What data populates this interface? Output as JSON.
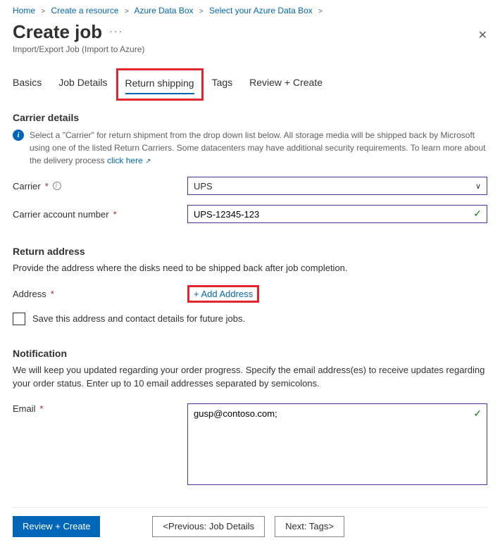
{
  "breadcrumb": [
    "Home",
    "Create a resource",
    "Azure Data Box",
    "Select your Azure Data Box"
  ],
  "page": {
    "title": "Create job",
    "subtitle": "Import/Export Job (Import to Azure)"
  },
  "tabs": {
    "basics": "Basics",
    "job_details": "Job Details",
    "return_shipping": "Return shipping",
    "tags": "Tags",
    "review": "Review + Create"
  },
  "carrier_section": {
    "heading": "Carrier details",
    "info_text": "Select a \"Carrier\" for return shipment from the drop down list below. All storage media will be shipped back by Microsoft using one of the listed Return Carriers. Some datacenters may have additional security requirements. To learn more about the delivery process ",
    "info_link": "click here",
    "carrier_label": "Carrier",
    "carrier_value": "UPS",
    "account_label": "Carrier account number",
    "account_value": "UPS-12345-123"
  },
  "return_section": {
    "heading": "Return address",
    "desc": "Provide the address where the disks need to be shipped back after job completion.",
    "address_label": "Address",
    "add_address": "+ Add Address",
    "save_label": "Save this address and contact details for future jobs."
  },
  "notification_section": {
    "heading": "Notification",
    "desc": "We will keep you updated regarding your order progress. Specify the email address(es) to receive updates regarding your order status. Enter up to 10 email addresses separated by semicolons.",
    "email_label": "Email",
    "email_value": "gusp@contoso.com;"
  },
  "footer": {
    "review": "Review + Create",
    "prev": "<Previous: Job Details",
    "next": "Next: Tags>"
  }
}
